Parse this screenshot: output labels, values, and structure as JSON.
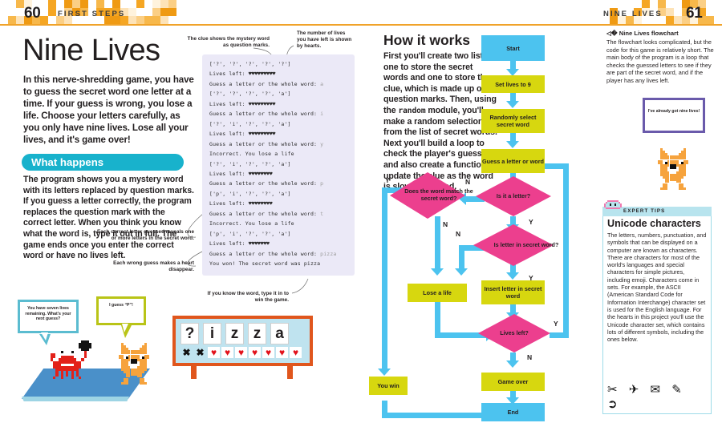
{
  "left_page": {
    "folio_number": "60",
    "running_head": "FIRST STEPS",
    "title": "Nine Lives",
    "intro": "In this nerve-shredding game, you have to guess the secret word one letter at a time. If your guess is wrong, you lose a life. Choose your letters carefully, as you only have nine lives. Lose all your lives, and it's game over!",
    "section_heading": "What happens",
    "section_body": "The program shows you a mystery word with its letters replaced by question marks. If you guess a letter correctly, the program replaces the question mark with the correct letter. When you think you know what the word is, type it out in full. The game ends once you enter the correct word or have no lives left.",
    "annotations": {
      "clue": "The clue shows the mystery word as question marks.",
      "lives": "The number of lives you have left is shown by hearts.",
      "correct": "Each correct letter guessed reveals one or more letters in the secret word.",
      "wrong": "Each wrong guess makes a heart disappear.",
      "win": "If you know the word, type it in to win the game."
    },
    "console_lines": [
      {
        "text": "['?', '?', '?', '?', '?']",
        "input": ""
      },
      {
        "text": "Lives left: ♥♥♥♥♥♥♥♥♥",
        "input": ""
      },
      {
        "text": "Guess a letter or the whole word: ",
        "input": "a"
      },
      {
        "text": "['?', '?', '?', '?', 'a']",
        "input": ""
      },
      {
        "text": "Lives left: ♥♥♥♥♥♥♥♥♥",
        "input": ""
      },
      {
        "text": "Guess a letter or the whole word: ",
        "input": "i"
      },
      {
        "text": "['?', 'i', '?', '?', 'a']",
        "input": ""
      },
      {
        "text": "Lives left: ♥♥♥♥♥♥♥♥♥",
        "input": ""
      },
      {
        "text": "Guess a letter or the whole word: ",
        "input": "y"
      },
      {
        "text": "Incorrect. You lose a life",
        "input": ""
      },
      {
        "text": "['?', 'i', '?', '?', 'a']",
        "input": ""
      },
      {
        "text": "Lives left: ♥♥♥♥♥♥♥♥",
        "input": ""
      },
      {
        "text": "Guess a letter or the whole word: ",
        "input": "p"
      },
      {
        "text": "['p', 'i', '?', '?', 'a']",
        "input": ""
      },
      {
        "text": "Lives left: ♥♥♥♥♥♥♥♥",
        "input": ""
      },
      {
        "text": "Guess a letter or the whole word: ",
        "input": "t"
      },
      {
        "text": "Incorrect. You lose a life",
        "input": ""
      },
      {
        "text": "['p', 'i', '?', '?', 'a']",
        "input": ""
      },
      {
        "text": "Lives left: ♥♥♥♥♥♥♥",
        "input": ""
      },
      {
        "text": "Guess a letter or the whole word: ",
        "input": "pizza"
      },
      {
        "text": "You won! The secret word was pizza",
        "input": ""
      }
    ],
    "illustration": {
      "crab_bubble": "You have seven lives remaining. What's your next guess?",
      "cat_bubble": "I guess “P”!",
      "board_tiles": [
        "?",
        "i",
        "z",
        "z",
        "a"
      ],
      "board_marks": [
        "x",
        "x",
        "heart",
        "heart",
        "heart",
        "heart",
        "heart",
        "heart",
        "heart"
      ]
    }
  },
  "right_page": {
    "folio_number": "61",
    "running_head": "NINE LIVES",
    "how_heading": "How it works",
    "how_body_1": "First you'll create two lists: one to store the secret words and one to store the clue, which is made up of question marks. Then, using the ",
    "how_body_mono": "random",
    "how_body_2": " module, you'll make a random selection from the list of secret words. Next you'll build a loop to check the player's guesses, and also create a function to update the clue as the word is slowly revealed.",
    "caption_heading": "Nine Lives flowchart",
    "caption_body": "The flowchart looks complicated, but the code for this game is relatively short. The main body of the program is a loop that checks the guessed letters to see if they are part of the secret word, and if the player has any lives left.",
    "cat_bubble": "I've already got nine lives!",
    "flowchart": {
      "start": "Start",
      "set_lives": "Set lives to 9",
      "random_select": "Randomly select secret word",
      "guess": "Guess a letter or word",
      "is_letter": "Is it a letter?",
      "word_match": "Does the word match the secret word?",
      "letter_in_word": "Is letter in secret word?",
      "lose_life": "Lose a life",
      "insert_letter": "Insert letter in secret word",
      "lives_left": "Lives left?",
      "you_win": "You win",
      "game_over": "Game over",
      "end": "End",
      "branch_labels": {
        "yes": "Y",
        "no": "N"
      }
    },
    "expert_tips": {
      "banner": "EXPERT TIPS",
      "heading": "Unicode characters",
      "body": "The letters, numbers, punctuation, and symbols that can be displayed on a computer are known as characters. There are characters for most of the world's languages and special characters for simple pictures, including emoji. Characters come in sets. For example, the ASCII (American Standard Code for Information Interchange) character set is used for the English language. For the hearts in this project you'll use the Unicode character set, which contains lots of different symbols, including the ones below.",
      "symbols": "✂ ✈ ✉ ✎ ➲"
    }
  },
  "colors": {
    "accent_orange": "#f0a32a",
    "teal_pill": "#18b2cc",
    "flow_blue": "#4cc3ef",
    "flow_yellow": "#d7d70f",
    "flow_pink": "#ec3f8e",
    "console_bg": "#ebe9f7",
    "board_frame": "#e0561d",
    "tips_blue": "#b8e4ee"
  }
}
